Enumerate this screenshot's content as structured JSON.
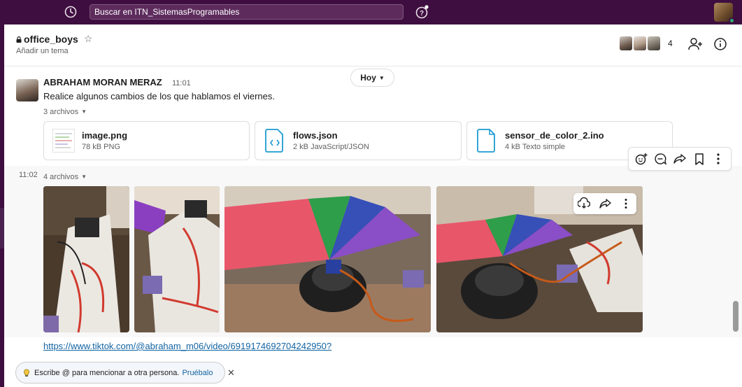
{
  "search": {
    "text": "Buscar en ITN_SistemasProgramables"
  },
  "channel": {
    "name": "office_boys",
    "topic": "Añadir un tema",
    "member_count": "4"
  },
  "date_divider": {
    "label": "Hoy"
  },
  "message1": {
    "sender": "ABRAHAM MORAN MERAZ",
    "time": "11:01",
    "text": "Realice algunos cambios de los que hablamos el viernes.",
    "files_label": "3 archivos",
    "files": [
      {
        "name": "image.png",
        "meta": "78 kB PNG",
        "icon": "image-thumbnail-icon"
      },
      {
        "name": "flows.json",
        "meta": "2 kB JavaScript/JSON",
        "icon": "code-file-icon"
      },
      {
        "name": "sensor_de_color_2.ino",
        "meta": "4 kB Texto simple",
        "icon": "text-file-icon"
      }
    ]
  },
  "message2": {
    "time": "11:02",
    "files_label": "4 archivos",
    "link": "https://www.tiktok.com/@abraham_m06/video/6919174692704242950?"
  },
  "tip": {
    "text": "Escribe @ para mencionar a otra persona.",
    "action": "Pruébalo"
  },
  "colors": {
    "sidebar": "#3f0e40",
    "link": "#1264a3",
    "presence": "#2bac76"
  }
}
